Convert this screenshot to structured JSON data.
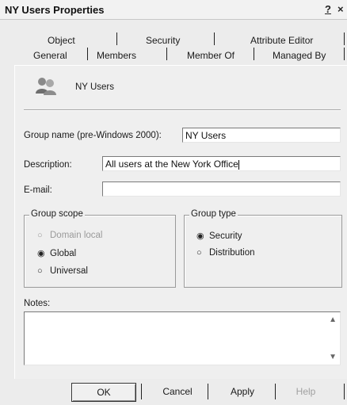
{
  "window": {
    "title": "NY Users Properties",
    "help_label": "?",
    "close_label": "×"
  },
  "tabs": {
    "row1": [
      "Object",
      "Security",
      "Attribute Editor"
    ],
    "row2": [
      "General",
      "Members",
      "Member Of",
      "Managed By"
    ],
    "active": "General"
  },
  "header": {
    "group_icon": "users-group-icon",
    "group_name": "NY Users"
  },
  "fields": {
    "group_name_label": "Group name (pre-Windows 2000):",
    "group_name_value": "NY Users",
    "description_label": "Description:",
    "description_value": "All users at the New York Office",
    "email_label": "E-mail:",
    "email_value": ""
  },
  "group_scope": {
    "legend": "Group scope",
    "options": [
      "Domain local",
      "Global",
      "Universal"
    ],
    "selected": "Global",
    "disabled": [
      "Domain local"
    ]
  },
  "group_type": {
    "legend": "Group type",
    "options": [
      "Security",
      "Distribution"
    ],
    "selected": "Security"
  },
  "notes": {
    "label": "Notes:",
    "value": ""
  },
  "buttons": {
    "ok": "OK",
    "cancel": "Cancel",
    "apply": "Apply",
    "help": "Help"
  }
}
